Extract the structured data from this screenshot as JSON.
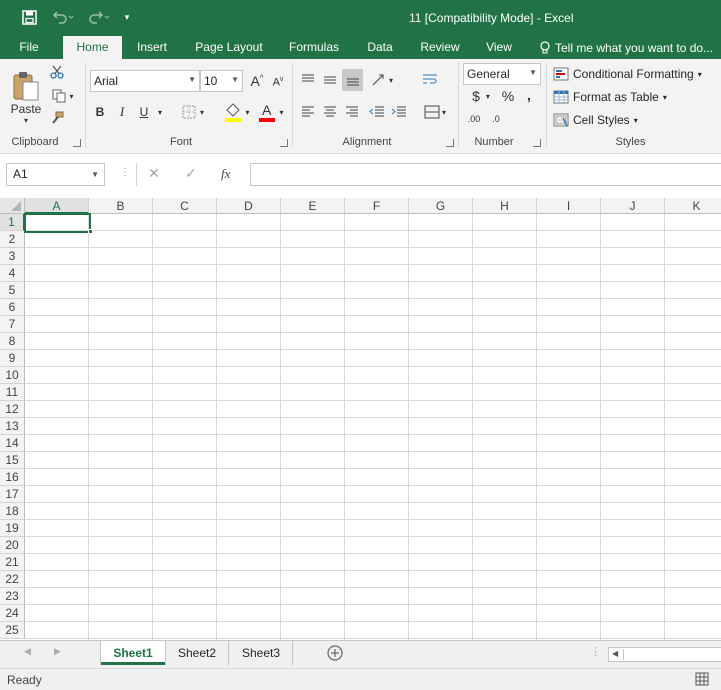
{
  "window": {
    "title": "11  [Compatibility Mode] - Excel"
  },
  "tabs": [
    {
      "label": "File"
    },
    {
      "label": "Home",
      "active": true
    },
    {
      "label": "Insert"
    },
    {
      "label": "Page Layout"
    },
    {
      "label": "Formulas"
    },
    {
      "label": "Data"
    },
    {
      "label": "Review"
    },
    {
      "label": "View"
    }
  ],
  "tell_me": "Tell me what you want to do...",
  "ribbon": {
    "clipboard": {
      "label": "Clipboard",
      "paste": "Paste"
    },
    "font": {
      "label": "Font",
      "name": "Arial",
      "size": "10",
      "bold": "B",
      "italic": "I",
      "underline": "U"
    },
    "alignment": {
      "label": "Alignment"
    },
    "number": {
      "label": "Number",
      "format": "General",
      "currency": "$",
      "percent": "%",
      "comma": ",",
      "inc_decimal": ".00",
      "dec_decimal": ".0"
    },
    "styles": {
      "label": "Styles",
      "conditional": "Conditional Formatting",
      "format_table": "Format as Table",
      "cell_styles": "Cell Styles"
    }
  },
  "formula_bar": {
    "name_box": "A1",
    "fx": "fx",
    "value": ""
  },
  "grid": {
    "columns": [
      "A",
      "B",
      "C",
      "D",
      "E",
      "F",
      "G",
      "H",
      "I",
      "J",
      "K"
    ],
    "rows": [
      "1",
      "2",
      "3",
      "4",
      "5",
      "6",
      "7",
      "8",
      "9",
      "10",
      "11",
      "12",
      "13",
      "14",
      "15",
      "16",
      "17",
      "18",
      "19",
      "20",
      "21",
      "22",
      "23",
      "24",
      "25"
    ],
    "active_cell": "A1"
  },
  "sheets": [
    {
      "label": "Sheet1",
      "active": true
    },
    {
      "label": "Sheet2"
    },
    {
      "label": "Sheet3"
    }
  ],
  "status": "Ready",
  "colors": {
    "accent": "#217346",
    "ribbon_bg": "#f3f3f3",
    "fill_color": "#ffff00",
    "font_color": "#ff0000"
  }
}
